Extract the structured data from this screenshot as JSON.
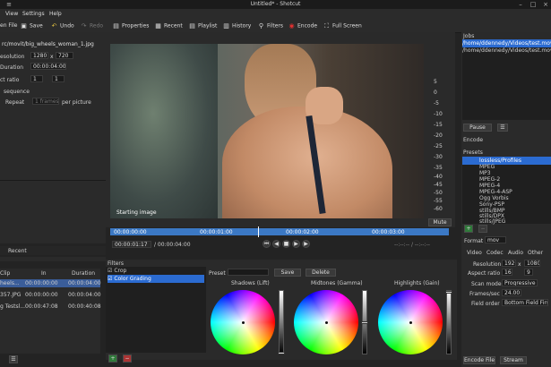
{
  "title": "Untitled* - Shotcut",
  "menu": {
    "view": "View",
    "settings": "Settings",
    "help": "Help"
  },
  "toolbar": {
    "open_file": "en File",
    "save": "Save",
    "undo": "Undo",
    "redo": "Redo",
    "properties": "Properties",
    "recent": "Recent",
    "playlist": "Playlist",
    "history": "History",
    "filters": "Filters",
    "encode": "Encode",
    "fullscreen": "Full Screen"
  },
  "properties": {
    "file": "rc/movit/big_wheels_woman_1.jpg",
    "resolution_label": "esolution",
    "res_w": "1280",
    "res_x": "x",
    "res_h": "720",
    "duration_label": "Duration",
    "duration": "00:00:04:00",
    "aspect_label": "ct ratio",
    "aspect_a": "1",
    "aspect_b": "1",
    "sequence": "sequence",
    "repeat_label": "Repeat",
    "repeat_val": "1 frames",
    "per_picture": "per picture"
  },
  "tabs_left": {
    "recent": "Recent"
  },
  "playlist": {
    "headers": [
      "Clip",
      "In",
      "Duration"
    ],
    "rows": [
      [
        "heels...",
        "00:00:00:00",
        "00:00:04:00"
      ],
      [
        "357.JPG",
        "00:00:00:00",
        "00:00:04:00"
      ],
      [
        "g Testsl...",
        "00:00:47:08",
        "00:00:40:08"
      ]
    ]
  },
  "viewer": {
    "caption": "Starting image",
    "mute": "Mute",
    "scale": [
      "5",
      "0",
      "-5",
      "-10",
      "-15",
      "-20",
      "-25",
      "-30",
      "-35",
      "-40",
      "-45",
      "-50",
      "-55",
      "-60"
    ],
    "ruler": [
      "00:00:00:00",
      "00:00:01:00",
      "00:00:02:00",
      "00:00:03:00"
    ],
    "position": "00:00:01:17",
    "duration": "/ 00:00:04:00",
    "transport": [
      "⏮",
      "◀",
      "■",
      "▶",
      "▶",
      "⏭"
    ],
    "range_hint": "--:--:-- / --:--:--"
  },
  "filters": {
    "heading": "Filters",
    "items": [
      {
        "label": "Crop",
        "checked": true,
        "selected": false
      },
      {
        "label": "Color Grading",
        "checked": true,
        "selected": true
      }
    ],
    "preset_label": "Preset",
    "save": "Save",
    "delete": "Delete",
    "wheels": [
      "Shadows (Lift)",
      "Midtones (Gamma)",
      "Highlights (Gain)"
    ],
    "add": "+",
    "remove": "−"
  },
  "jobs": {
    "heading": "Jobs",
    "items": [
      "/home/ddennedy/Videos/test.mov",
      "/home/ddennedy/Videos/test.mov"
    ],
    "pause": "Pause",
    "menu": "☰"
  },
  "encode": {
    "heading": "Encode",
    "presets_label": "Presets",
    "presets": [
      "lossless/Profiles",
      "MPEG",
      "MP3",
      "MPEG-2",
      "MPEG-4",
      "MPEG-4-ASP",
      "Ogg Vorbis",
      "Sony-PSP",
      "stills/BMP",
      "stills/DPX",
      "stills/JPEG"
    ],
    "format_label": "Format",
    "format_val": "mov",
    "tabs": [
      "Video",
      "Codec",
      "Audio",
      "Other"
    ],
    "resolution_label": "Resolution",
    "res_w": "1920",
    "res_x": "x",
    "res_h": "1080",
    "aspect_label": "Aspect ratio",
    "aspect_a": "16",
    "aspect_b": "9",
    "scan_label": "Scan mode",
    "scan_val": "Progressive",
    "fps_label": "Frames/sec",
    "fps_val": "24.00",
    "field_label": "Field order",
    "field_val": "Bottom Field First",
    "encode_file": "Encode File",
    "stream": "Stream"
  },
  "colors": {
    "accent": "#2b6bd1",
    "selection": "#3a5d99",
    "timeline": "#3b78c4"
  }
}
